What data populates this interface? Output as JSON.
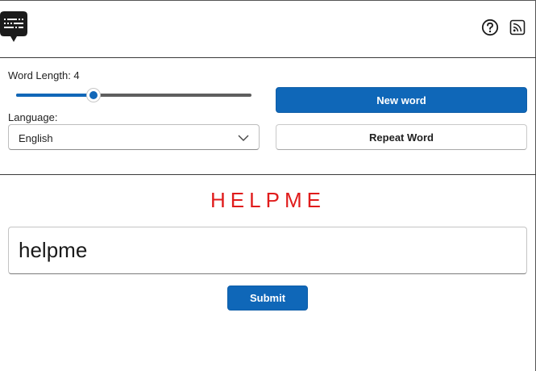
{
  "header": {
    "logo_icon": "chat-keyboard-icon",
    "help_icon": "help-circle-icon",
    "rss_icon": "rss-feed-icon"
  },
  "settings": {
    "word_length_label": "Word Length: 4",
    "word_length": {
      "value": 4,
      "fraction": 0.33
    },
    "language_label": "Language:",
    "language_selected": "English"
  },
  "actions": {
    "new_word_label": "New word",
    "repeat_word_label": "Repeat Word"
  },
  "challenge": {
    "target_word": "HELPME"
  },
  "answer": {
    "value": "helpme"
  },
  "submit_label": "Submit",
  "colors": {
    "accent": "#0f67b8",
    "target_word": "#e01c1c",
    "slider_track": "#5e5e5e"
  }
}
